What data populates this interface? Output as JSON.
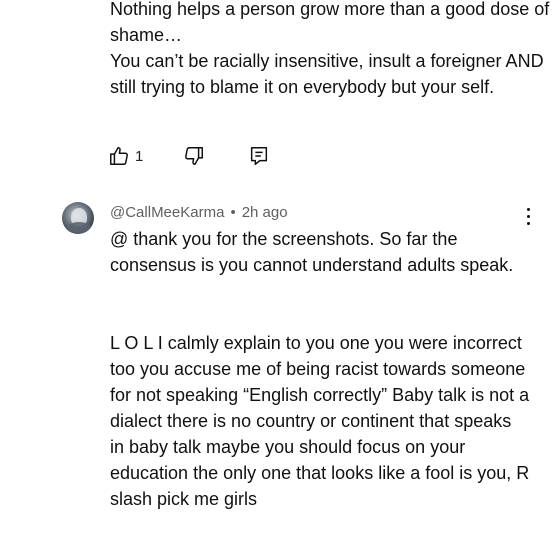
{
  "comment1": {
    "lines": [
      "Nothing helps a person grow more than a good dose of shame…",
      "You can’t be racially insensitive, insult a foreigner AND still trying to blame it on everybody but your self."
    ],
    "like_count": "1",
    "icons": {
      "like": "thumbs-up-icon",
      "dislike": "thumbs-down-icon",
      "reply": "reply-icon"
    }
  },
  "comment2": {
    "author": "@CallMeeKarma",
    "separator": "•",
    "time": "2h ago",
    "paragraphs": [
      "@ thank you for the screenshots. So far the consensus is you cannot understand adults speak.",
      "L O L I calmly explain to you one you were incorrect too you accuse me of being racist towards someone for not speaking “English correctly” Baby talk is not a dialect there is no country or continent that speaks in baby talk maybe you should focus on your education the only one that looks like a fool is you, R slash pick me girls"
    ],
    "icons": {
      "avatar": "avatar",
      "menu": "more-vertical-icon"
    }
  }
}
